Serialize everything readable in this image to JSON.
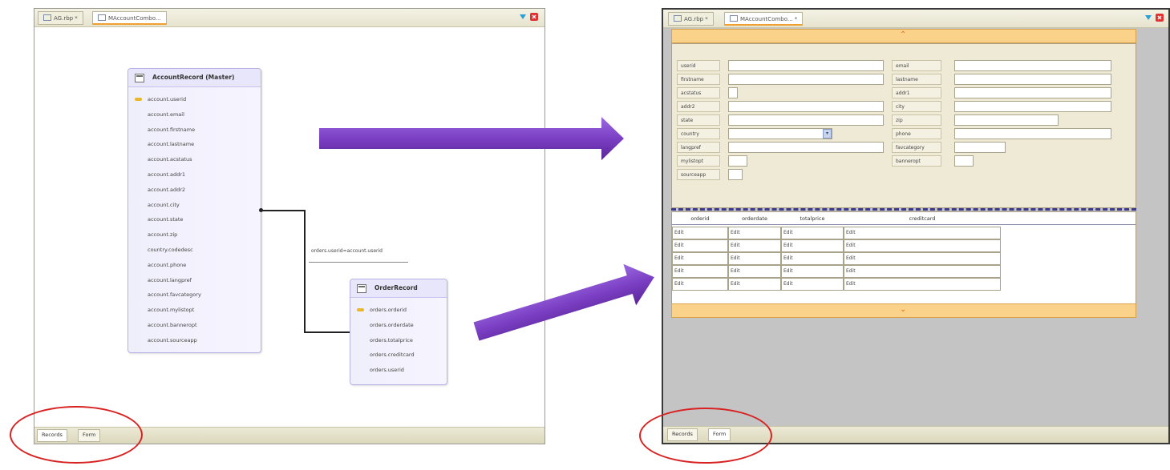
{
  "left_window": {
    "tabs": [
      {
        "label": "AG.rbp *",
        "active": false
      },
      {
        "label": "MAccountCombo...",
        "active": true
      }
    ],
    "bottom_tabs": [
      {
        "label": "Records",
        "active": true
      },
      {
        "label": "Form",
        "active": false
      }
    ],
    "entities": {
      "account": {
        "title": "AccountRecord (Master)",
        "fields": [
          "account.userid",
          "account.email",
          "account.firstname",
          "account.lastname",
          "account.acstatus",
          "account.addr1",
          "account.addr2",
          "account.city",
          "account.state",
          "account.zip",
          "country.codedesc",
          "account.phone",
          "account.langpref",
          "account.favcategory",
          "account.mylistopt",
          "account.banneropt",
          "account.sourceapp"
        ]
      },
      "orders": {
        "title": "OrderRecord",
        "fields": [
          "orders.orderid",
          "orders.orderdate",
          "orders.totalprice",
          "orders.creditcard",
          "orders.userid"
        ]
      }
    },
    "relation_label": "orders.userid=account.userid"
  },
  "right_window": {
    "tabs": [
      {
        "label": "AG.rbp *",
        "active": false
      },
      {
        "label": "MAccountCombo... *",
        "active": true
      }
    ],
    "bottom_tabs": [
      {
        "label": "Records",
        "active": false
      },
      {
        "label": "Form",
        "active": true
      }
    ],
    "form_fields_left": [
      {
        "label": "userid"
      },
      {
        "label": "firstname"
      },
      {
        "label": "acstatus"
      },
      {
        "label": "addr2"
      },
      {
        "label": "state"
      },
      {
        "label": "country"
      },
      {
        "label": "langpref"
      },
      {
        "label": "mylistopt"
      },
      {
        "label": "sourceapp"
      }
    ],
    "form_fields_right": [
      {
        "label": "email"
      },
      {
        "label": "lastname"
      },
      {
        "label": "addr1"
      },
      {
        "label": "city"
      },
      {
        "label": "zip"
      },
      {
        "label": "phone"
      },
      {
        "label": "favcategory"
      },
      {
        "label": "banneropt"
      }
    ],
    "grid": {
      "columns": [
        "orderid",
        "orderdate",
        "totalprice",
        "creditcard"
      ],
      "rows": [
        [
          "Edit",
          "Edit",
          "Edit",
          "Edit"
        ],
        [
          "Edit",
          "Edit",
          "Edit",
          "Edit"
        ],
        [
          "Edit",
          "Edit",
          "Edit",
          "Edit"
        ],
        [
          "Edit",
          "Edit",
          "Edit",
          "Edit"
        ],
        [
          "Edit",
          "Edit",
          "Edit",
          "Edit"
        ]
      ]
    }
  },
  "colors": {
    "arrow": "#7b3fc4",
    "highlight_oval": "#d82222",
    "orange_bar": "#fbd28a"
  }
}
